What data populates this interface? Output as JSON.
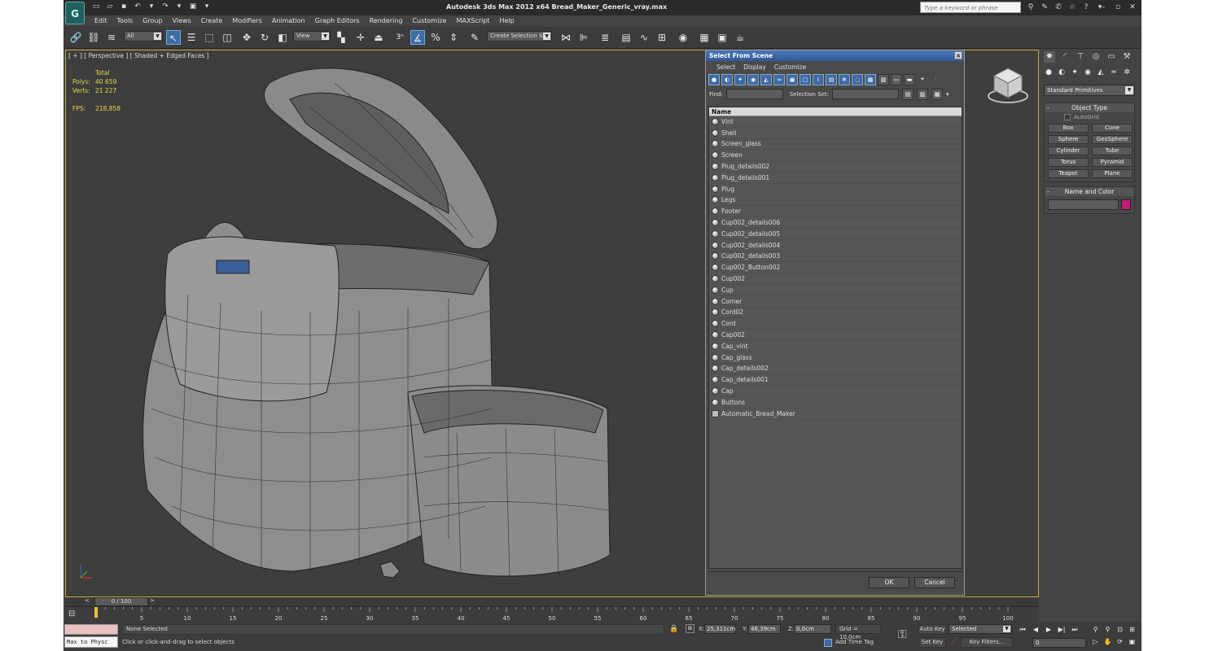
{
  "app": {
    "logo": "G",
    "title": "Autodesk 3ds Max  2012 x64     Bread_Maker_Generic_vray.max",
    "search_placeholder": "Type a keyword or phrase"
  },
  "menu": [
    "Edit",
    "Tools",
    "Group",
    "Views",
    "Create",
    "Modifiers",
    "Animation",
    "Graph Editors",
    "Rendering",
    "Customize",
    "MAXScript",
    "Help"
  ],
  "toolbar": {
    "filter_value": "All",
    "refcoord_value": "View",
    "snap_num": "3",
    "named_selection_placeholder": "Create Selection Se"
  },
  "viewport": {
    "label": "[ + ] [ Perspective ] [ Shaded + Edged Faces ]",
    "stats": {
      "total_label": "Total",
      "polys_label": "Polys:",
      "polys": "40 659",
      "verts_label": "Verts:",
      "verts": "21 227",
      "fps_label": "FPS:",
      "fps": "218,858"
    }
  },
  "dialog": {
    "title": "Select From Scene",
    "close": "×",
    "menu": [
      "Select",
      "Display",
      "Customize"
    ],
    "find_label": "Find:",
    "selection_set_label": "Selection Set:",
    "column_name": "Name",
    "items": [
      "Vint",
      "Shell",
      "Screen_glass",
      "Screen",
      "Plug_details002",
      "Plug_details001",
      "Plug",
      "Legs",
      "Footer",
      "Cup002_details006",
      "Cup002_details005",
      "Cup002_details004",
      "Cup002_details003",
      "Cup002_Button002",
      "Cup002",
      "Cup",
      "Corner",
      "Cord02",
      "Cord",
      "Cap002",
      "Cap_vint",
      "Cap_glass",
      "Cap_details002",
      "Cap_details001",
      "Cap",
      "Buttons",
      "Automatic_Bread_Maker"
    ],
    "ok": "OK",
    "cancel": "Cancel"
  },
  "command_panel": {
    "dropdown": "Standard Primitives",
    "object_type_title": "Object Type",
    "autogrid_label": "AutoGrid",
    "buttons": [
      "Box",
      "Cone",
      "Sphere",
      "GeoSphere",
      "Cylinder",
      "Tube",
      "Torus",
      "Pyramid",
      "Teapot",
      "Plane"
    ],
    "name_color_title": "Name and Color",
    "color": "#c41d78"
  },
  "timeline": {
    "position": "0 / 100",
    "prev": "<",
    "next": ">",
    "ticks": [
      "5",
      "10",
      "15",
      "20",
      "25",
      "30",
      "35",
      "40",
      "45",
      "50",
      "55",
      "60",
      "65",
      "70",
      "75",
      "80",
      "85",
      "90",
      "95",
      "100"
    ]
  },
  "status": {
    "maxscript": "Max to Physc",
    "selection": "None Selected",
    "prompt": "Click or click-and-drag to select objects",
    "x_label": "X:",
    "x": "25,311cm",
    "y_label": "Y:",
    "y": "46,39cm",
    "z_label": "Z:",
    "z": "0,0cm",
    "grid": "Grid = 10,0cm",
    "add_time_tag": "Add Time Tag",
    "auto_key": "Auto Key",
    "set_key": "Set Key",
    "key_mode": "Selected",
    "key_filters": "Key Filters...",
    "frame": "0"
  }
}
